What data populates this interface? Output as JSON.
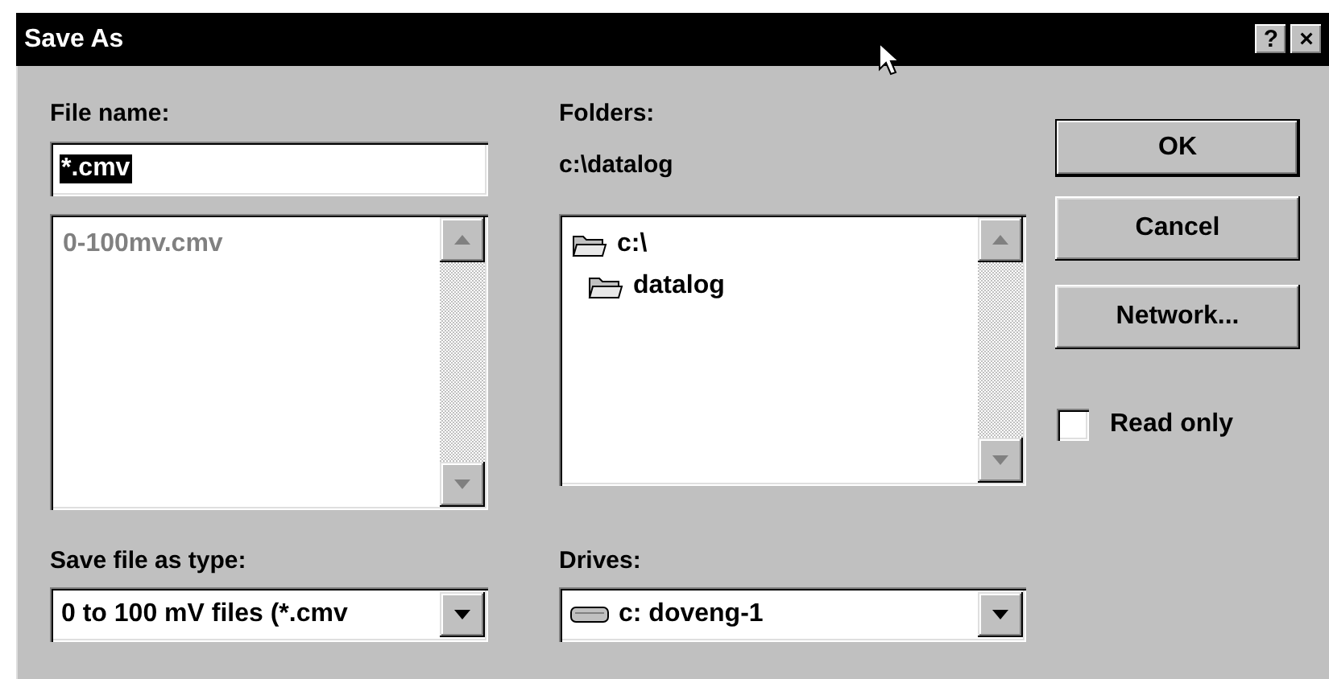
{
  "window": {
    "title": "Save As",
    "title_buttons": [
      "?",
      "×"
    ]
  },
  "file_name": {
    "label": "File name:",
    "value": "*.cmv",
    "text_selected": true
  },
  "files": {
    "items": [
      {
        "label": "0-100mv.cmv",
        "disabled": true
      }
    ]
  },
  "folders": {
    "label": "Folders:",
    "path": "c:\\datalog",
    "items": [
      {
        "label": "c:\\",
        "children": [
          {
            "label": "datalog"
          }
        ]
      }
    ]
  },
  "save_type": {
    "label": "Save file as type:",
    "value": "0 to 100 mV files (*.cmv"
  },
  "drives": {
    "label": "Drives:",
    "value": "c: doveng-1"
  },
  "buttons": [
    {
      "label": "OK",
      "default": true
    },
    {
      "label": "Cancel",
      "default": false
    },
    {
      "label": "Network...",
      "default": false
    }
  ],
  "read_only": {
    "label": "Read only",
    "checked": false
  }
}
